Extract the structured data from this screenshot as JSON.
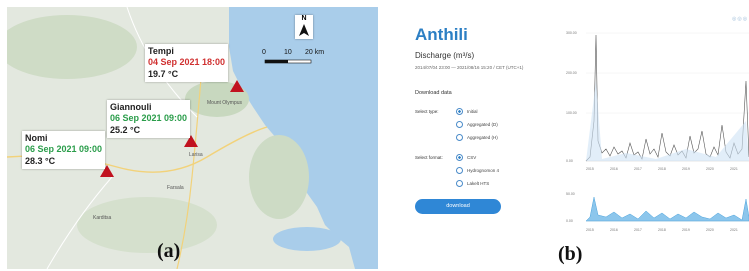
{
  "map_panel": {
    "label": "(a)",
    "north_letter": "N",
    "scale_labels": [
      "0",
      "10",
      "20 km"
    ],
    "place_labels": [
      "Mount Olympus",
      "Karditsa",
      "Farsala",
      "Larisa"
    ],
    "stations": [
      {
        "name": "Tempi",
        "date": "04 Sep 2021 18:00",
        "temp": "19.7 °C",
        "date_color": "#d03030"
      },
      {
        "name": "Giannouli",
        "date": "06 Sep 2021 09:00",
        "temp": "25.2 °C",
        "date_color": "#2a9d4a"
      },
      {
        "name": "Nomi",
        "date": "06 Sep 2021 09:00",
        "temp": "28.3 °C",
        "date_color": "#2a9d4a"
      }
    ]
  },
  "dashboard": {
    "label": "(b)",
    "title": "Anthili",
    "subtitle": "Discharge (m³/s)",
    "range": "2014/07/04 23:00 — 2021/08/16 15:20 / CET (UTC+1)",
    "section_title": "Download data",
    "select_type_label": "Select type:",
    "type_options": [
      {
        "label": "Initial",
        "selected": true
      },
      {
        "label": "Aggregated (D)",
        "selected": false
      },
      {
        "label": "Aggregated (H)",
        "selected": false
      }
    ],
    "select_format_label": "Select format:",
    "format_options": [
      {
        "label": "CSV",
        "selected": true
      },
      {
        "label": "Hydrognomon 4",
        "selected": false
      },
      {
        "label": "Lakelt HTS",
        "selected": false
      }
    ],
    "download_label": "download",
    "top_chart_y_ticks": [
      "300.00",
      "200.00",
      "100.00",
      "0.00"
    ],
    "x_ticks": [
      "2015",
      "2016",
      "2017",
      "2018",
      "2019",
      "2020",
      "2021"
    ],
    "bottom_chart_y_ticks": [
      "50.00",
      "0.00"
    ],
    "accent_color": "#2c7fc4"
  }
}
